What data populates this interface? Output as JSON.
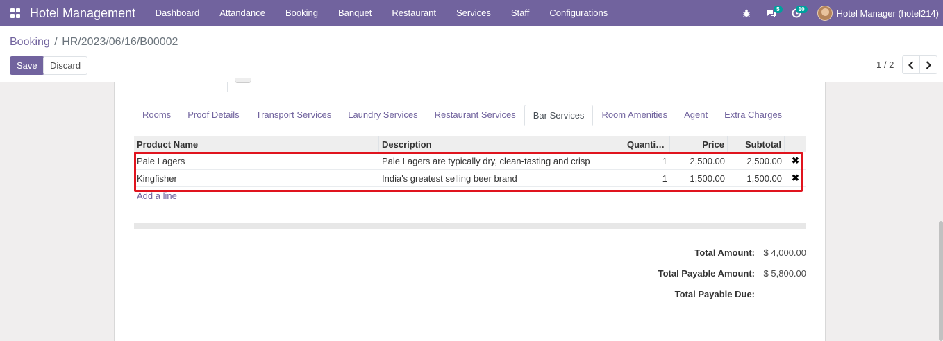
{
  "navbar": {
    "brand": "Hotel Management",
    "menu": [
      "Dashboard",
      "Attandance",
      "Booking",
      "Banquet",
      "Restaurant",
      "Services",
      "Staff",
      "Configurations"
    ],
    "messages_count": "5",
    "activities_count": "10",
    "user": "Hotel Manager (hotel214)"
  },
  "breadcrumb": {
    "parent": "Booking",
    "separator": "/",
    "current": "HR/2023/06/16/B00002"
  },
  "buttons": {
    "save": "Save",
    "discard": "Discard"
  },
  "pager": {
    "value": "1 / 2"
  },
  "tabs": [
    {
      "label": "Rooms",
      "active": false
    },
    {
      "label": "Proof Details",
      "active": false
    },
    {
      "label": "Transport Services",
      "active": false
    },
    {
      "label": "Laundry Services",
      "active": false
    },
    {
      "label": "Restaurant Services",
      "active": false
    },
    {
      "label": "Bar Services",
      "active": true
    },
    {
      "label": "Room Amenities",
      "active": false
    },
    {
      "label": "Agent",
      "active": false
    },
    {
      "label": "Extra Charges",
      "active": false
    }
  ],
  "table": {
    "columns": [
      "Product Name",
      "Description",
      "Quantity…",
      "Price",
      "Subtotal"
    ],
    "rows": [
      {
        "product": "Pale Lagers",
        "description": "Pale Lagers are typically dry, clean-tasting and crisp",
        "quantity": "1",
        "price": "2,500.00",
        "subtotal": "2,500.00"
      },
      {
        "product": "Kingfisher",
        "description": "India's greatest selling beer brand",
        "quantity": "1",
        "price": "1,500.00",
        "subtotal": "1,500.00"
      }
    ],
    "add_line": "Add a line"
  },
  "totals": {
    "total_amount_label": "Total Amount:",
    "total_amount": "$ 4,000.00",
    "total_payable_label": "Total Payable Amount:",
    "total_payable": "$ 5,800.00",
    "total_due_label": "Total Payable Due:",
    "total_due": ""
  },
  "colors": {
    "brand": "#71639e",
    "highlight": "#e0141e",
    "badge": "#00a09d"
  }
}
